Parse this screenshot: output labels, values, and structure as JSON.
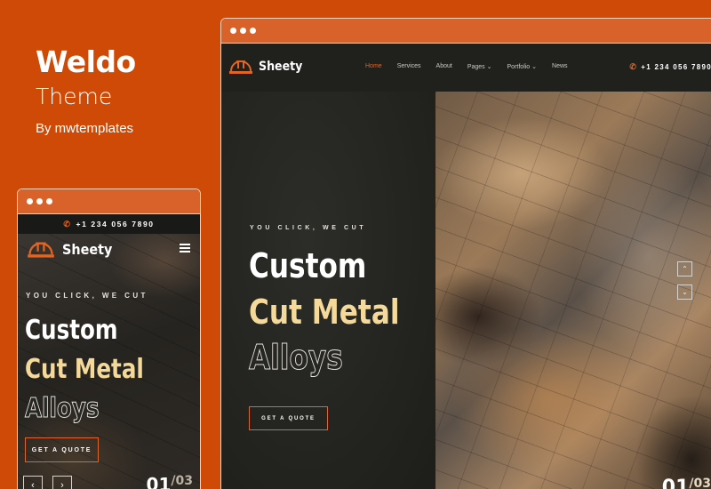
{
  "promo": {
    "name": "Weldo",
    "theme": "Theme",
    "by": "By mwtemplates"
  },
  "site": {
    "logo": "Sheety",
    "nav": [
      {
        "label": "Home",
        "active": true,
        "dropdown": false
      },
      {
        "label": "Services",
        "active": false,
        "dropdown": false
      },
      {
        "label": "About",
        "active": false,
        "dropdown": false
      },
      {
        "label": "Pages",
        "active": false,
        "dropdown": true
      },
      {
        "label": "Portfolio",
        "active": false,
        "dropdown": true
      },
      {
        "label": "News",
        "active": false,
        "dropdown": false
      }
    ],
    "phone": "+1 234 056 7890",
    "hero": {
      "eyebrow": "YOU CLICK, WE CUT",
      "line1": "Custom",
      "line2": "Cut Metal",
      "line3": "Alloys",
      "cta": "GET A QUOTE"
    },
    "slider": {
      "current": "01",
      "total": "/03"
    }
  },
  "icons": {
    "logo": "hard-hat-icon",
    "phone": "phone-icon",
    "menu": "hamburger-icon",
    "dropdown": "chevron-down-icon",
    "up": "chevron-up-icon",
    "down": "chevron-down-icon",
    "prev": "chevron-left-icon",
    "next": "chevron-right-icon"
  },
  "colors": {
    "background": "#cf4a06",
    "accent": "#e06524",
    "highlight": "#f4d99a",
    "dark": "#262622"
  }
}
